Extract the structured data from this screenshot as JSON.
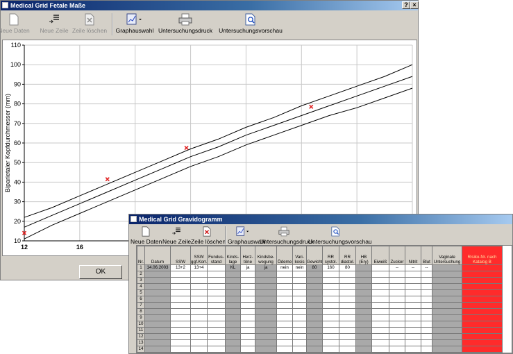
{
  "fetal_window": {
    "title": "Medical Grid Fetale Maße",
    "help_btn": "?",
    "close_btn": "×",
    "toolbar": {
      "new_data": "Neue Daten",
      "new_row": "Neue Zeile",
      "delete_row": "Zeile löschen",
      "graph_select": "Graphauswahl",
      "print": "Untersuchungsdruck",
      "preview": "Untersuchungsvorschau"
    },
    "ok_label": "OK"
  },
  "chart_data": {
    "type": "line",
    "title": "",
    "xlabel": "",
    "ylabel": "Biparietaler Kopfdurchmesser (mm)",
    "xlim": [
      12,
      40
    ],
    "ylim": [
      10,
      110
    ],
    "x_ticks_visible": [
      "12",
      "16"
    ],
    "y_ticks": [
      "10",
      "20",
      "30",
      "40",
      "50",
      "60",
      "70",
      "80",
      "90",
      "100",
      "110"
    ],
    "grid": true,
    "series": [
      {
        "values": [
          [
            12,
            22
          ],
          [
            14,
            27
          ],
          [
            16,
            33
          ],
          [
            18,
            39
          ],
          [
            20,
            45
          ],
          [
            22,
            51
          ],
          [
            24,
            57
          ],
          [
            26,
            62
          ],
          [
            28,
            68
          ],
          [
            30,
            73
          ],
          [
            32,
            79
          ],
          [
            34,
            84
          ],
          [
            36,
            89
          ],
          [
            38,
            94
          ],
          [
            40,
            100
          ]
        ]
      },
      {
        "values": [
          [
            12,
            17
          ],
          [
            14,
            23
          ],
          [
            16,
            29
          ],
          [
            18,
            35
          ],
          [
            20,
            41
          ],
          [
            22,
            47
          ],
          [
            24,
            53
          ],
          [
            26,
            58
          ],
          [
            28,
            64
          ],
          [
            30,
            69
          ],
          [
            32,
            74
          ],
          [
            34,
            79
          ],
          [
            36,
            84
          ],
          [
            38,
            89
          ],
          [
            40,
            94
          ]
        ]
      },
      {
        "values": [
          [
            12,
            11
          ],
          [
            14,
            18
          ],
          [
            16,
            24
          ],
          [
            18,
            30
          ],
          [
            20,
            36
          ],
          [
            22,
            42
          ],
          [
            24,
            48
          ],
          [
            26,
            53
          ],
          [
            28,
            59
          ],
          [
            30,
            64
          ],
          [
            32,
            69
          ],
          [
            34,
            74
          ],
          [
            36,
            78
          ],
          [
            38,
            83
          ],
          [
            40,
            88
          ]
        ]
      }
    ],
    "points": [
      [
        12,
        14
      ],
      [
        18,
        41.5
      ],
      [
        23.7,
        57.5
      ],
      [
        32.7,
        78.5
      ]
    ]
  },
  "grav_window": {
    "title": "Medical Grid Gravidogramm",
    "toolbar": {
      "new_data": "Neue Daten",
      "new_row": "Neue Zeile",
      "delete_row": "Zeile löschen",
      "graph_select": "Graphauswahl",
      "print": "Untersuchungsdruck",
      "preview": "Untersuchungsvorschau"
    },
    "columns": [
      "Nr.",
      "Datum",
      "SSW",
      "SSW ggf.Korr.",
      "Fundus-stand",
      "Kinds-lage",
      "Herz-töne",
      "Kindsbe-wegung",
      "Ödeme",
      "Vari-kosis",
      "Gewicht",
      "RR systol.",
      "RR diastol.",
      "HB (Ery)",
      "Eiweiß",
      "Zucker",
      "Nitrit",
      "Blut",
      "Vaginale Untersuchung",
      "Risiko-Nr. nach Katalog B"
    ],
    "rows": [
      [
        "1",
        "14.06.2003",
        "13+2",
        "13+4",
        "",
        "KL",
        "ja",
        "ja",
        "nein",
        "nein",
        "80",
        "160",
        "80",
        "",
        "",
        "--",
        "--",
        "--",
        "",
        ""
      ],
      [
        "2"
      ],
      [
        "3"
      ],
      [
        "4"
      ],
      [
        "5"
      ],
      [
        "6"
      ],
      [
        "7"
      ],
      [
        "8"
      ],
      [
        "9"
      ],
      [
        "10"
      ],
      [
        "11"
      ],
      [
        "12"
      ],
      [
        "13"
      ],
      [
        "14"
      ]
    ]
  }
}
